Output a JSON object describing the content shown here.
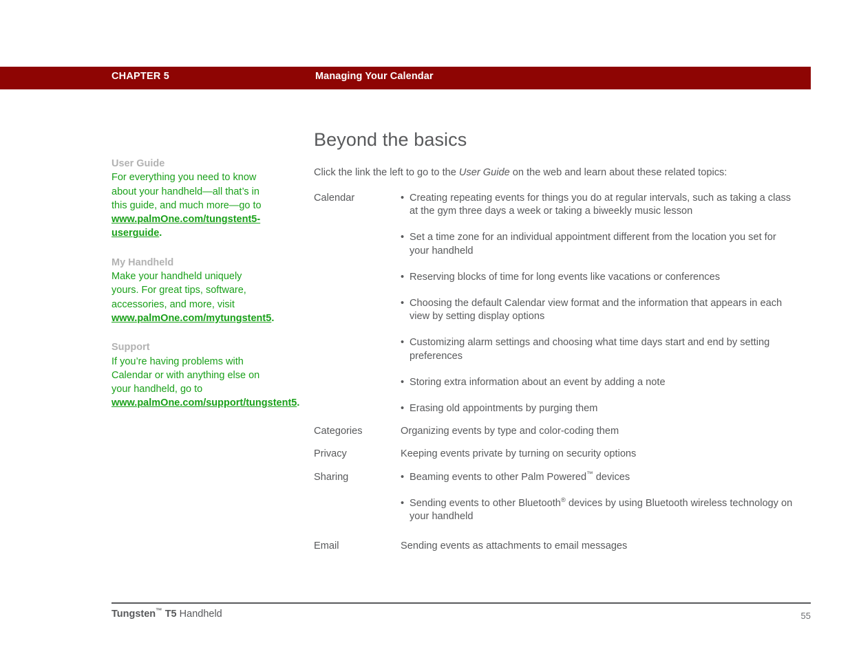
{
  "header": {
    "chapter_label": "CHAPTER 5",
    "chapter_title": "Managing Your Calendar",
    "bar_color": "#8e0503"
  },
  "sidebar": {
    "blocks": [
      {
        "heading": "User Guide",
        "body": "For everything you need to know about your handheld—all that’s in this guide, and much more—go to ",
        "link": "www.palmOne.com/tungstent5-userguide",
        "trailing": "."
      },
      {
        "heading": "My Handheld",
        "body": "Make your handheld uniquely yours. For great tips, software, accessories, and more, visit ",
        "link": "www.palmOne.com/mytungstent5",
        "trailing": "."
      },
      {
        "heading": "Support",
        "body": "If you’re having problems with Calendar or with anything else on your handheld, go to ",
        "link": "www.palmOne.com/support/tungstent5",
        "trailing": "."
      }
    ],
    "heading_color": "#b2b2b2",
    "link_color": "#1aa01a"
  },
  "main": {
    "page_title": "Beyond the basics",
    "intro_before": "Click the link the left to go to the ",
    "intro_italic": "User Guide",
    "intro_after": " on the web and learn about these related topics:"
  },
  "topics": {
    "calendar_label": "Calendar",
    "calendar_bullets": [
      "Creating repeating events for things you do at regular intervals, such as taking a class at the gym three days a week or taking a biweekly music lesson",
      "Set a time zone for an individual appointment different from the location you set for your handheld",
      "Reserving blocks of time for long events like vacations or conferences",
      "Choosing the default Calendar view format and the information that appears in each view by setting display options",
      "Customizing alarm settings and choosing what time days start and end by setting preferences",
      "Storing extra information about an event by adding a note",
      "Erasing old appointments by purging them"
    ],
    "categories_label": "Categories",
    "categories_text": "Organizing events by type and color-coding them",
    "privacy_label": "Privacy",
    "privacy_text": "Keeping events private by turning on security options",
    "sharing_label": "Sharing",
    "sharing_bullet_1_before": "Beaming events to other Palm Powered",
    "sharing_bullet_1_sup": "™",
    "sharing_bullet_1_after": "  devices",
    "sharing_bullet_2_before": "Sending events to other Bluetooth",
    "sharing_bullet_2_sup": "®",
    "sharing_bullet_2_after": " devices by using Bluetooth wireless technology on your handheld",
    "email_label": "Email",
    "email_text": "Sending events as attachments to email messages",
    "bullet_glyph": "•"
  },
  "footer": {
    "product_bold": "Tungsten",
    "product_sup": "™",
    "product_model": " T5",
    "product_rest": " Handheld",
    "page_number": "55"
  }
}
